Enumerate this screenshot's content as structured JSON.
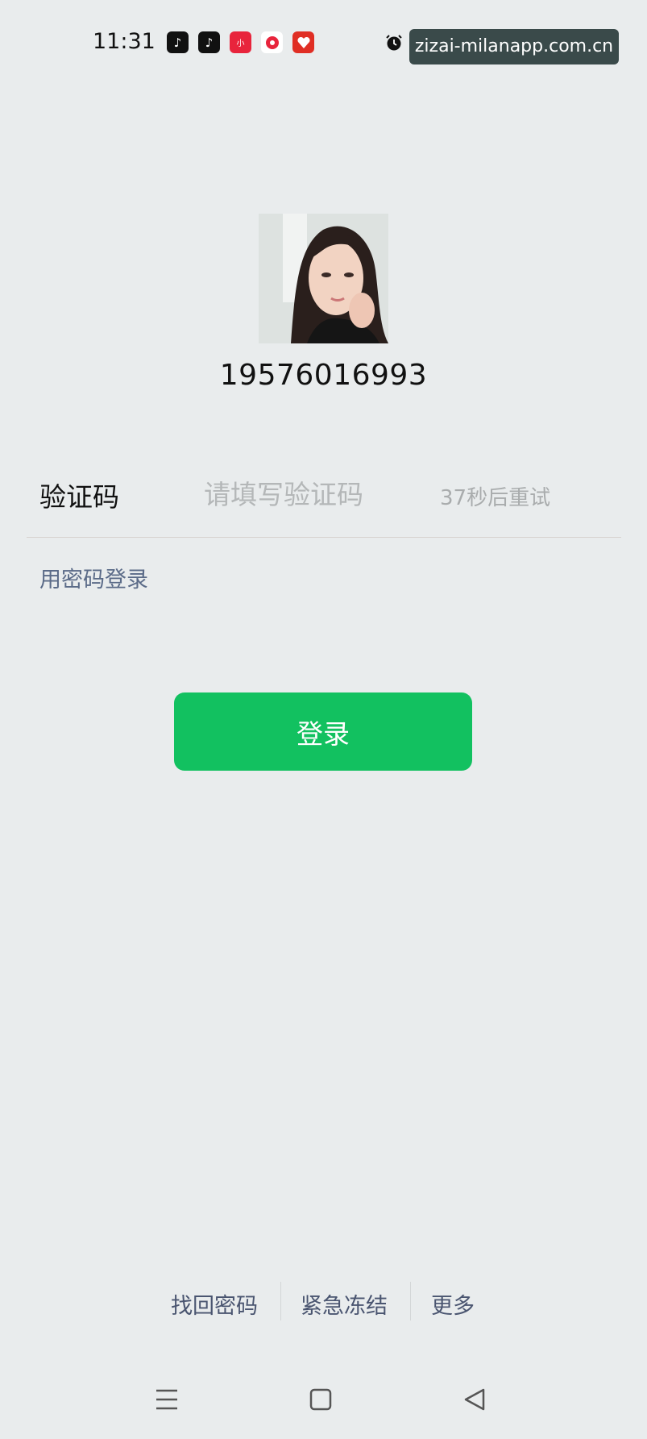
{
  "status_bar": {
    "time": "11:31",
    "app_icons": [
      "tiktok-icon",
      "tiktok-icon",
      "xiaohongshu-icon",
      "video-app-icon",
      "pinduoduo-icon"
    ],
    "icons": [
      "alarm-icon"
    ]
  },
  "watermark": "zizai-milanapp.com.cn",
  "account": {
    "phone": "19576016993"
  },
  "code_field": {
    "label": "验证码",
    "placeholder": "请填写验证码",
    "resend": "37秒后重试"
  },
  "password_login": "用密码登录",
  "login_button": "登录",
  "bottom_links": {
    "recover": "找回密码",
    "freeze": "紧急冻结",
    "more": "更多"
  },
  "nav_bar": {
    "icons": [
      "menu-icon",
      "home-icon",
      "back-icon"
    ]
  },
  "colors": {
    "background": "#e9eced",
    "primary_green": "#12c160",
    "link_blue": "#5b6b88"
  }
}
